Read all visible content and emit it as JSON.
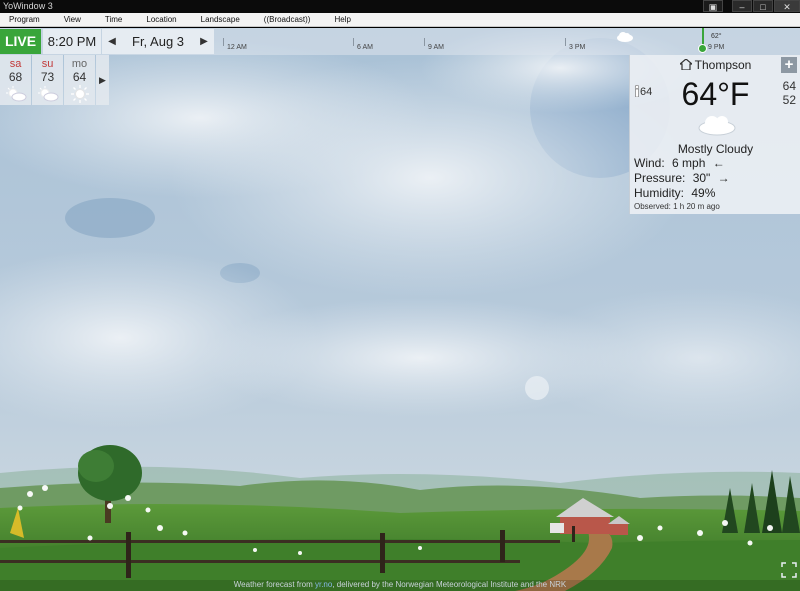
{
  "window": {
    "title": "YoWindow 3",
    "controls": {
      "minimize": "–",
      "maximize": "□",
      "close": "✕"
    }
  },
  "menu": [
    "Program",
    "View",
    "Time",
    "Location",
    "Landscape",
    "((Broadcast))",
    "Help"
  ],
  "timebar": {
    "live_label": "LIVE",
    "clock": "8:20 PM",
    "date": "Fr, Aug 3",
    "hours": [
      "12 AM",
      "6 AM",
      "9 AM",
      "3 PM",
      "9 PM"
    ],
    "now_temp": "62°"
  },
  "forecast": [
    {
      "day": "sa",
      "temp": "68",
      "icon": "partly-cloudy-icon",
      "color": "#c23a3a"
    },
    {
      "day": "su",
      "temp": "73",
      "icon": "partly-cloudy-icon",
      "color": "#c23a3a"
    },
    {
      "day": "mo",
      "temp": "64",
      "icon": "sun-icon",
      "color": "#666666"
    }
  ],
  "current": {
    "location": "Thompson",
    "temperature": "64°F",
    "feels_like": "64",
    "high": "64",
    "low": "52",
    "condition": "Mostly Cloudy",
    "wind_label": "Wind:",
    "wind_value": "6 mph",
    "wind_arrow": "←",
    "pressure_label": "Pressure:",
    "pressure_value": "30\"",
    "pressure_arrow": "→",
    "humidity_label": "Humidity:",
    "humidity_value": "49%",
    "observed": "Observed:  1 h 20 m ago"
  },
  "footer": {
    "prefix": "Weather forecast from ",
    "link": "yr.no",
    "suffix": ", delivered by the Norwegian Meteorological Institute and the NRK"
  },
  "colors": {
    "live": "#39a53a",
    "sky": "#9eb8cd",
    "grass": "#3f7f2a"
  }
}
